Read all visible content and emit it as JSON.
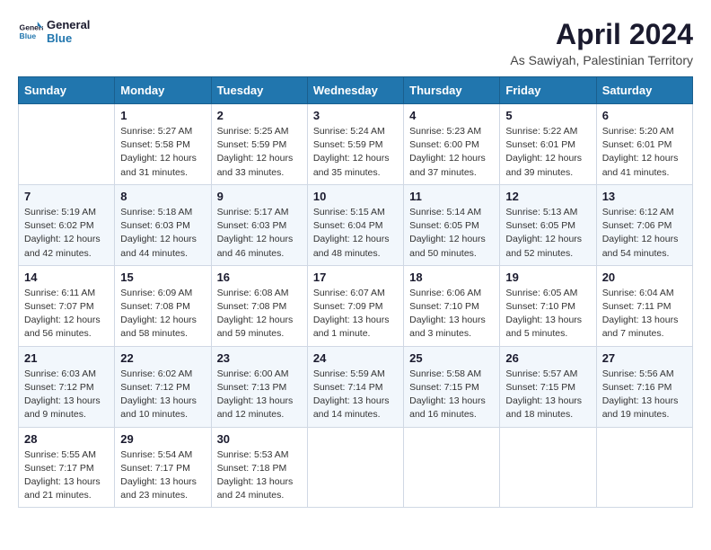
{
  "logo": {
    "text_general": "General",
    "text_blue": "Blue"
  },
  "title": "April 2024",
  "subtitle": "As Sawiyah, Palestinian Territory",
  "days_of_week": [
    "Sunday",
    "Monday",
    "Tuesday",
    "Wednesday",
    "Thursday",
    "Friday",
    "Saturday"
  ],
  "weeks": [
    [
      {
        "day": "",
        "info": ""
      },
      {
        "day": "1",
        "info": "Sunrise: 5:27 AM\nSunset: 5:58 PM\nDaylight: 12 hours\nand 31 minutes."
      },
      {
        "day": "2",
        "info": "Sunrise: 5:25 AM\nSunset: 5:59 PM\nDaylight: 12 hours\nand 33 minutes."
      },
      {
        "day": "3",
        "info": "Sunrise: 5:24 AM\nSunset: 5:59 PM\nDaylight: 12 hours\nand 35 minutes."
      },
      {
        "day": "4",
        "info": "Sunrise: 5:23 AM\nSunset: 6:00 PM\nDaylight: 12 hours\nand 37 minutes."
      },
      {
        "day": "5",
        "info": "Sunrise: 5:22 AM\nSunset: 6:01 PM\nDaylight: 12 hours\nand 39 minutes."
      },
      {
        "day": "6",
        "info": "Sunrise: 5:20 AM\nSunset: 6:01 PM\nDaylight: 12 hours\nand 41 minutes."
      }
    ],
    [
      {
        "day": "7",
        "info": "Sunrise: 5:19 AM\nSunset: 6:02 PM\nDaylight: 12 hours\nand 42 minutes."
      },
      {
        "day": "8",
        "info": "Sunrise: 5:18 AM\nSunset: 6:03 PM\nDaylight: 12 hours\nand 44 minutes."
      },
      {
        "day": "9",
        "info": "Sunrise: 5:17 AM\nSunset: 6:03 PM\nDaylight: 12 hours\nand 46 minutes."
      },
      {
        "day": "10",
        "info": "Sunrise: 5:15 AM\nSunset: 6:04 PM\nDaylight: 12 hours\nand 48 minutes."
      },
      {
        "day": "11",
        "info": "Sunrise: 5:14 AM\nSunset: 6:05 PM\nDaylight: 12 hours\nand 50 minutes."
      },
      {
        "day": "12",
        "info": "Sunrise: 5:13 AM\nSunset: 6:05 PM\nDaylight: 12 hours\nand 52 minutes."
      },
      {
        "day": "13",
        "info": "Sunrise: 6:12 AM\nSunset: 7:06 PM\nDaylight: 12 hours\nand 54 minutes."
      }
    ],
    [
      {
        "day": "14",
        "info": "Sunrise: 6:11 AM\nSunset: 7:07 PM\nDaylight: 12 hours\nand 56 minutes."
      },
      {
        "day": "15",
        "info": "Sunrise: 6:09 AM\nSunset: 7:08 PM\nDaylight: 12 hours\nand 58 minutes."
      },
      {
        "day": "16",
        "info": "Sunrise: 6:08 AM\nSunset: 7:08 PM\nDaylight: 12 hours\nand 59 minutes."
      },
      {
        "day": "17",
        "info": "Sunrise: 6:07 AM\nSunset: 7:09 PM\nDaylight: 13 hours\nand 1 minute."
      },
      {
        "day": "18",
        "info": "Sunrise: 6:06 AM\nSunset: 7:10 PM\nDaylight: 13 hours\nand 3 minutes."
      },
      {
        "day": "19",
        "info": "Sunrise: 6:05 AM\nSunset: 7:10 PM\nDaylight: 13 hours\nand 5 minutes."
      },
      {
        "day": "20",
        "info": "Sunrise: 6:04 AM\nSunset: 7:11 PM\nDaylight: 13 hours\nand 7 minutes."
      }
    ],
    [
      {
        "day": "21",
        "info": "Sunrise: 6:03 AM\nSunset: 7:12 PM\nDaylight: 13 hours\nand 9 minutes."
      },
      {
        "day": "22",
        "info": "Sunrise: 6:02 AM\nSunset: 7:12 PM\nDaylight: 13 hours\nand 10 minutes."
      },
      {
        "day": "23",
        "info": "Sunrise: 6:00 AM\nSunset: 7:13 PM\nDaylight: 13 hours\nand 12 minutes."
      },
      {
        "day": "24",
        "info": "Sunrise: 5:59 AM\nSunset: 7:14 PM\nDaylight: 13 hours\nand 14 minutes."
      },
      {
        "day": "25",
        "info": "Sunrise: 5:58 AM\nSunset: 7:15 PM\nDaylight: 13 hours\nand 16 minutes."
      },
      {
        "day": "26",
        "info": "Sunrise: 5:57 AM\nSunset: 7:15 PM\nDaylight: 13 hours\nand 18 minutes."
      },
      {
        "day": "27",
        "info": "Sunrise: 5:56 AM\nSunset: 7:16 PM\nDaylight: 13 hours\nand 19 minutes."
      }
    ],
    [
      {
        "day": "28",
        "info": "Sunrise: 5:55 AM\nSunset: 7:17 PM\nDaylight: 13 hours\nand 21 minutes."
      },
      {
        "day": "29",
        "info": "Sunrise: 5:54 AM\nSunset: 7:17 PM\nDaylight: 13 hours\nand 23 minutes."
      },
      {
        "day": "30",
        "info": "Sunrise: 5:53 AM\nSunset: 7:18 PM\nDaylight: 13 hours\nand 24 minutes."
      },
      {
        "day": "",
        "info": ""
      },
      {
        "day": "",
        "info": ""
      },
      {
        "day": "",
        "info": ""
      },
      {
        "day": "",
        "info": ""
      }
    ]
  ]
}
